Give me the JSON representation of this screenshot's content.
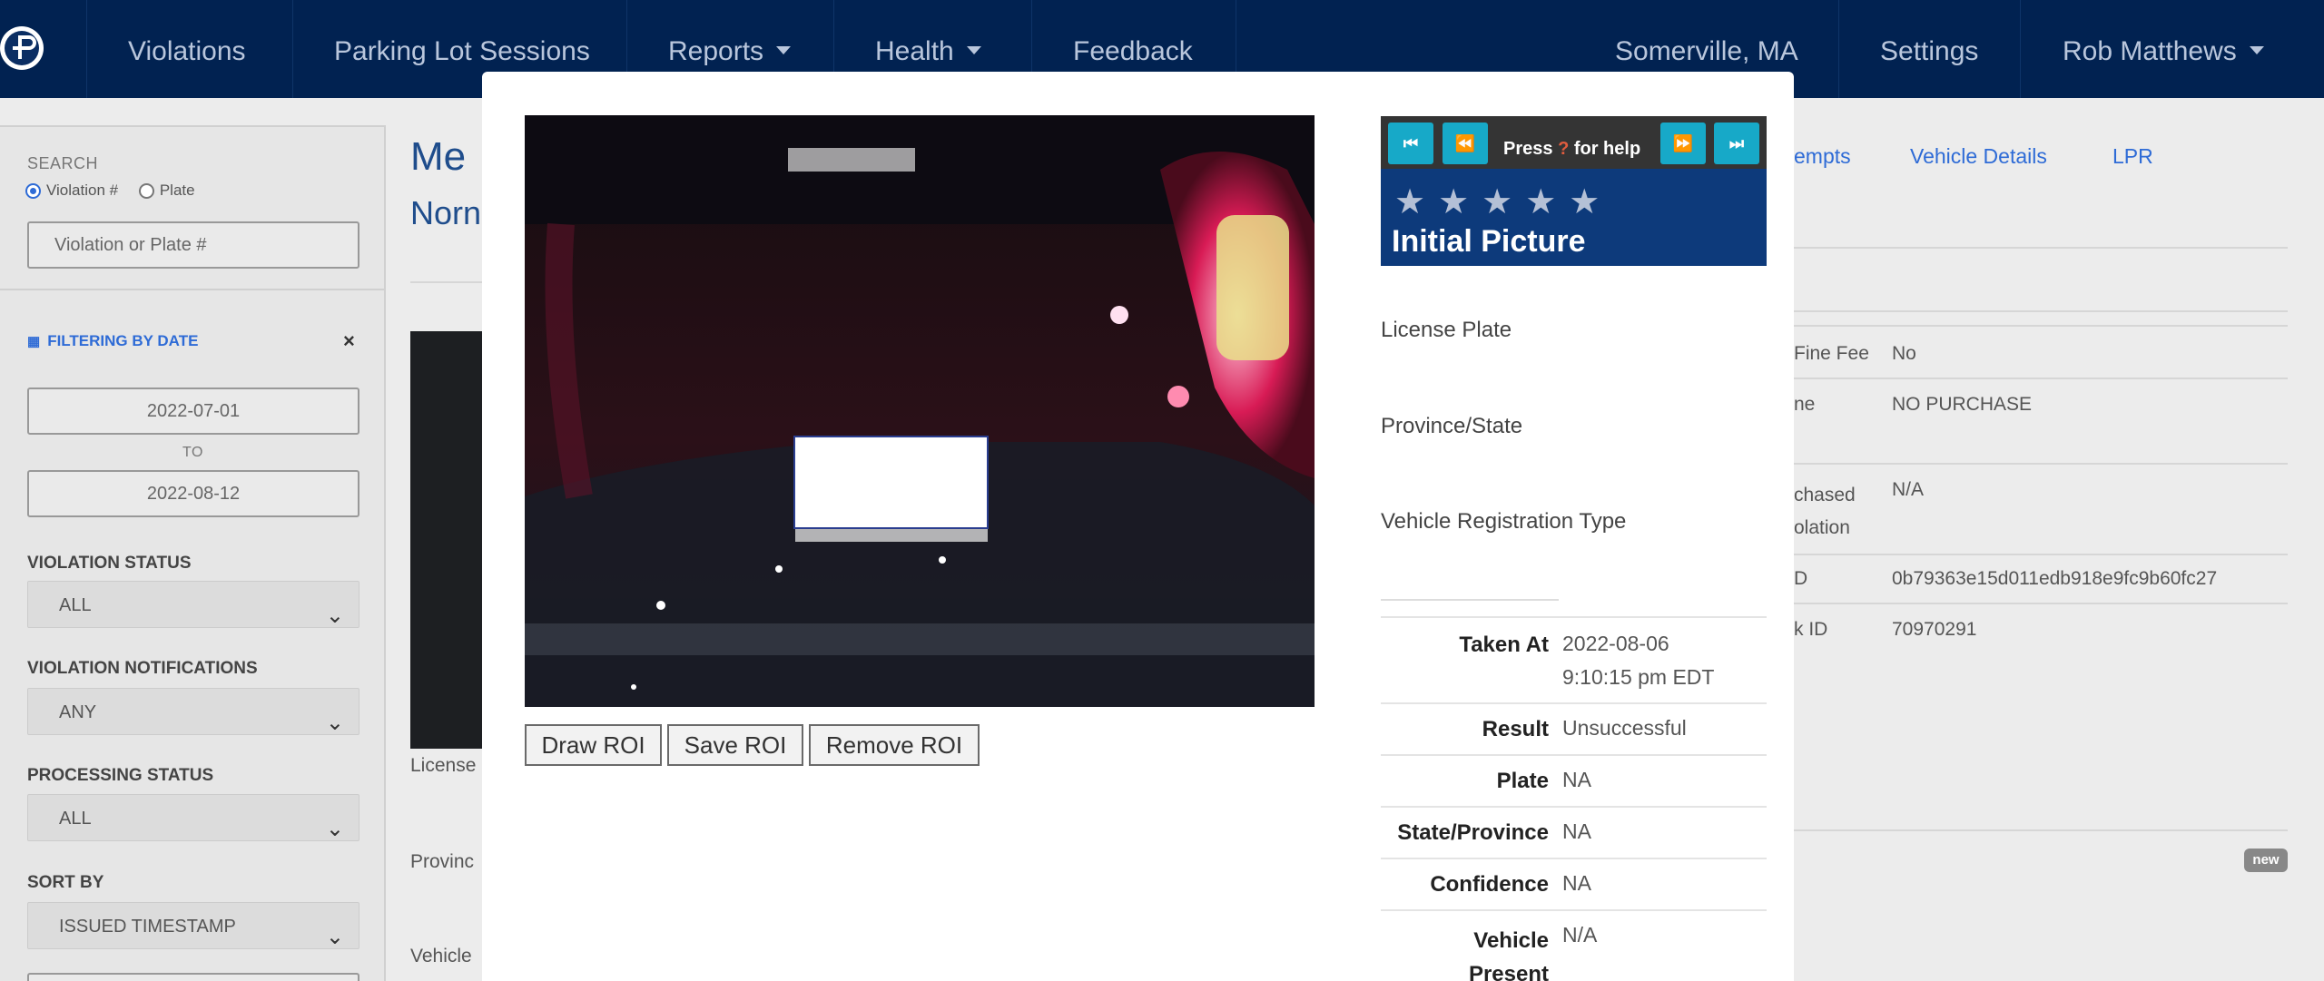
{
  "navbar": {
    "items": [
      "Violations",
      "Parking Lot Sessions",
      "Reports",
      "Health",
      "Feedback"
    ],
    "location": "Somerville, MA",
    "settings": "Settings",
    "user": "Rob Matthews",
    "colors": {
      "background": "#012251",
      "text": "#b9c6dc"
    }
  },
  "sidebar": {
    "search_label": "SEARCH",
    "radio_violation": "Violation #",
    "radio_plate": "Plate",
    "search_placeholder": "Violation or Plate #",
    "filter_label": "FILTERING BY DATE",
    "date_from": "2022-07-01",
    "to_label": "TO",
    "date_to": "2022-08-12",
    "violation_status_label": "VIOLATION STATUS",
    "violation_status_value": "ALL",
    "violation_notifications_label": "VIOLATION NOTIFICATIONS",
    "violation_notifications_value": "ANY",
    "processing_status_label": "PROCESSING STATUS",
    "processing_status_value": "ALL",
    "sort_by_label": "SORT BY",
    "sort_by_value": "ISSUED TIMESTAMP"
  },
  "background": {
    "title": "Me",
    "subtitle": "Norn",
    "left_labels": [
      "License",
      "Provinc",
      "Vehicle"
    ],
    "tabs": [
      "empts",
      "Vehicle Details",
      "LPR"
    ],
    "details": [
      {
        "label": "Fine Fee",
        "value": "No"
      },
      {
        "label": "ne",
        "value": "NO PURCHASE"
      },
      {
        "label": "chased\nolation",
        "value": "N/A"
      },
      {
        "label": "D",
        "value": "0b79363e15d011edb918e9fc9b60fc27"
      },
      {
        "label": "k ID",
        "value": "70970291"
      }
    ],
    "badge": "new"
  },
  "modal": {
    "roi_buttons": [
      "Draw ROI",
      "Save ROI",
      "Remove ROI"
    ],
    "viewer": {
      "help_prefix": "Press",
      "help_key": "?",
      "help_suffix": "for help",
      "nav_first": "⏮",
      "nav_prev": "⏪",
      "nav_next": "⏩",
      "nav_last": "⏭",
      "stars": "★★★★★",
      "title": "Initial Picture"
    },
    "fields": [
      "License Plate",
      "Province/State",
      "Vehicle Registration Type"
    ],
    "info": [
      {
        "key": "Taken At",
        "value": "2022-08-06\n9:10:15 pm EDT"
      },
      {
        "key": "Result",
        "value": "Unsuccessful"
      },
      {
        "key": "Plate",
        "value": "NA"
      },
      {
        "key": "State/Province",
        "value": "NA"
      },
      {
        "key": "Confidence",
        "value": "NA"
      },
      {
        "key": "Vehicle\nPresent",
        "value": "N/A"
      }
    ]
  }
}
